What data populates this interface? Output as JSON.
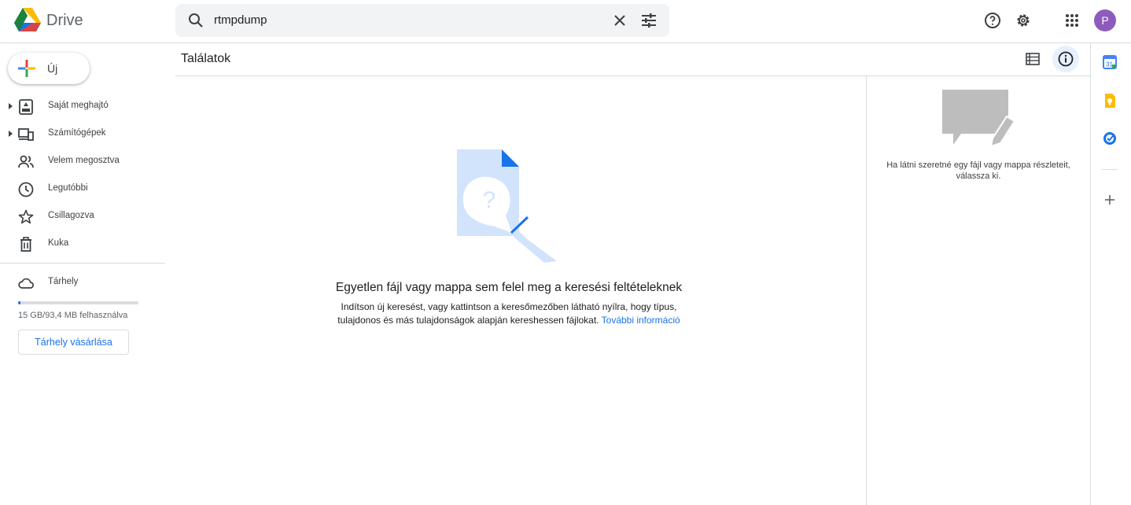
{
  "header": {
    "brand": "Drive",
    "search_value": "rtmpdump",
    "avatar_letter": "P"
  },
  "nav": {
    "new_label": "Új",
    "items": [
      {
        "label": "Saját meghajtó",
        "icon": "my-drive-icon"
      },
      {
        "label": "Számítógépek",
        "icon": "computers-icon"
      },
      {
        "label": "Velem megosztva",
        "icon": "shared-icon"
      },
      {
        "label": "Legutóbbi",
        "icon": "recent-icon"
      },
      {
        "label": "Csillagozva",
        "icon": "star-icon"
      },
      {
        "label": "Kuka",
        "icon": "trash-icon"
      }
    ],
    "storage_label": "Tárhely",
    "storage_usage": "15 GB/93,4 MB felhasználva",
    "storage_fraction": 0.006,
    "buy_label": "Tárhely vásárlása"
  },
  "main": {
    "title": "Találatok",
    "empty_title": "Egyetlen fájl vagy mappa sem felel meg a keresési feltételeknek",
    "empty_desc": "Indítson új keresést, vagy kattintson a keresőmezőben látható nyílra, hogy típus, tulajdonos és más tulajdonságok alapján kereshessen fájlokat.",
    "learn_more": "További információ"
  },
  "details": {
    "hint": "Ha látni szeretné egy fájl vagy mappa részleteit, válassza ki."
  },
  "rail": {
    "calendar_day": "31"
  },
  "colors": {
    "accent": "#1a73e8",
    "avatar": "#8e5bbd"
  }
}
